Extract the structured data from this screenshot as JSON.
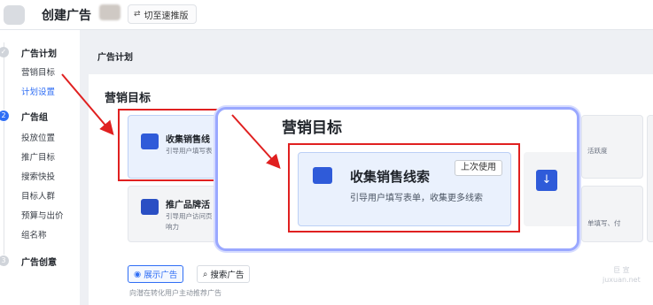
{
  "header": {
    "title": "创建广告",
    "switch_label": "切至速推版"
  },
  "sidebar": {
    "steps": [
      {
        "num": "✓",
        "label": "广告计划",
        "items": [
          "营销目标",
          "计划设置"
        ]
      },
      {
        "num": "2",
        "label": "广告组",
        "items": [
          "投放位置",
          "推广目标",
          "搜索快投",
          "目标人群",
          "预算与出价",
          "组名称"
        ]
      },
      {
        "num": "3",
        "label": "广告创意",
        "items": []
      }
    ]
  },
  "main": {
    "plan_header": "广告计划",
    "section_title": "营销目标",
    "cards": {
      "leads_title": "收集销售线",
      "leads_desc": "引导用户填写表",
      "brand_title": "推广品牌活",
      "brand_desc_1": "引导用户访问页",
      "brand_desc_2": "响力",
      "right_desc_1": "活跃度",
      "right_desc_2": "单填写、付"
    },
    "tabs": [
      "展示广告",
      "搜索广告"
    ],
    "tab_hint": "向潜在转化用户主动推荐广告"
  },
  "zoom": {
    "title": "营销目标",
    "card_title": "收集销售线索",
    "card_desc": "引导用户填写表单，收集更多线索",
    "badge": "上次使用"
  },
  "watermark": {
    "line1": "巨 宣",
    "line2": "juxuan.net"
  },
  "colors": {
    "accent": "#2f6ef5",
    "highlight_red": "#e02020",
    "icon_blue": "#2f5bd9"
  }
}
